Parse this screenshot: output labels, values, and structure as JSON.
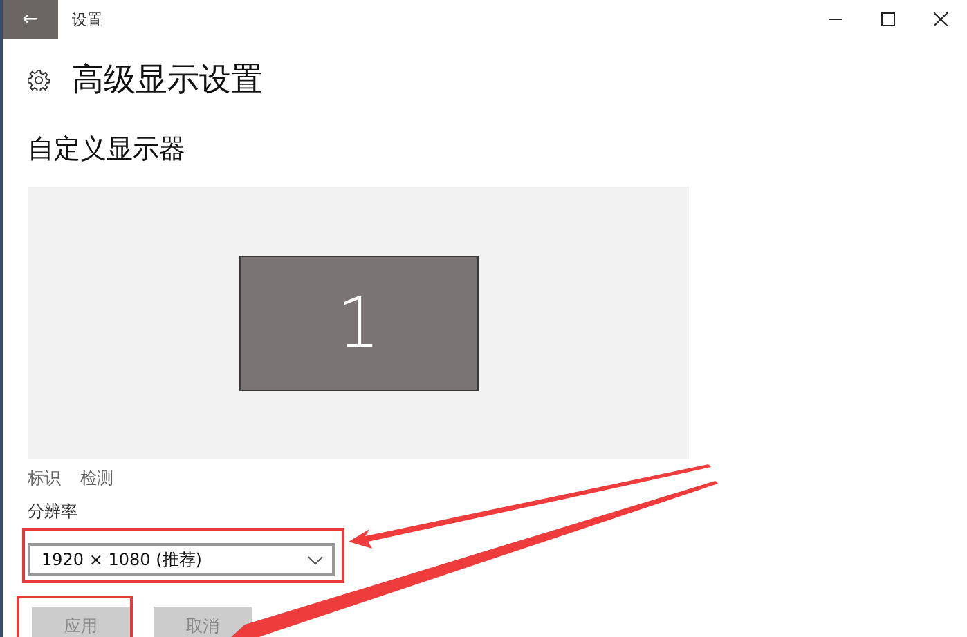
{
  "window": {
    "title": "设置",
    "back_button": "←",
    "controls": [
      {
        "kind": "minimize"
      },
      {
        "kind": "maximize"
      },
      {
        "kind": "close"
      }
    ]
  },
  "page_title": "高级显示设置",
  "section_title": "自定义显示器",
  "display_preview": {
    "monitors": [
      {
        "label": "1",
        "selected": true
      }
    ]
  },
  "links": [
    "标识",
    "检测"
  ],
  "resolution": {
    "label": "分辨率",
    "value": "1920 × 1080 (推荐)"
  },
  "buttons": [
    {
      "label": "应用",
      "disabled": true
    },
    {
      "label": "取消",
      "disabled": true
    }
  ]
}
